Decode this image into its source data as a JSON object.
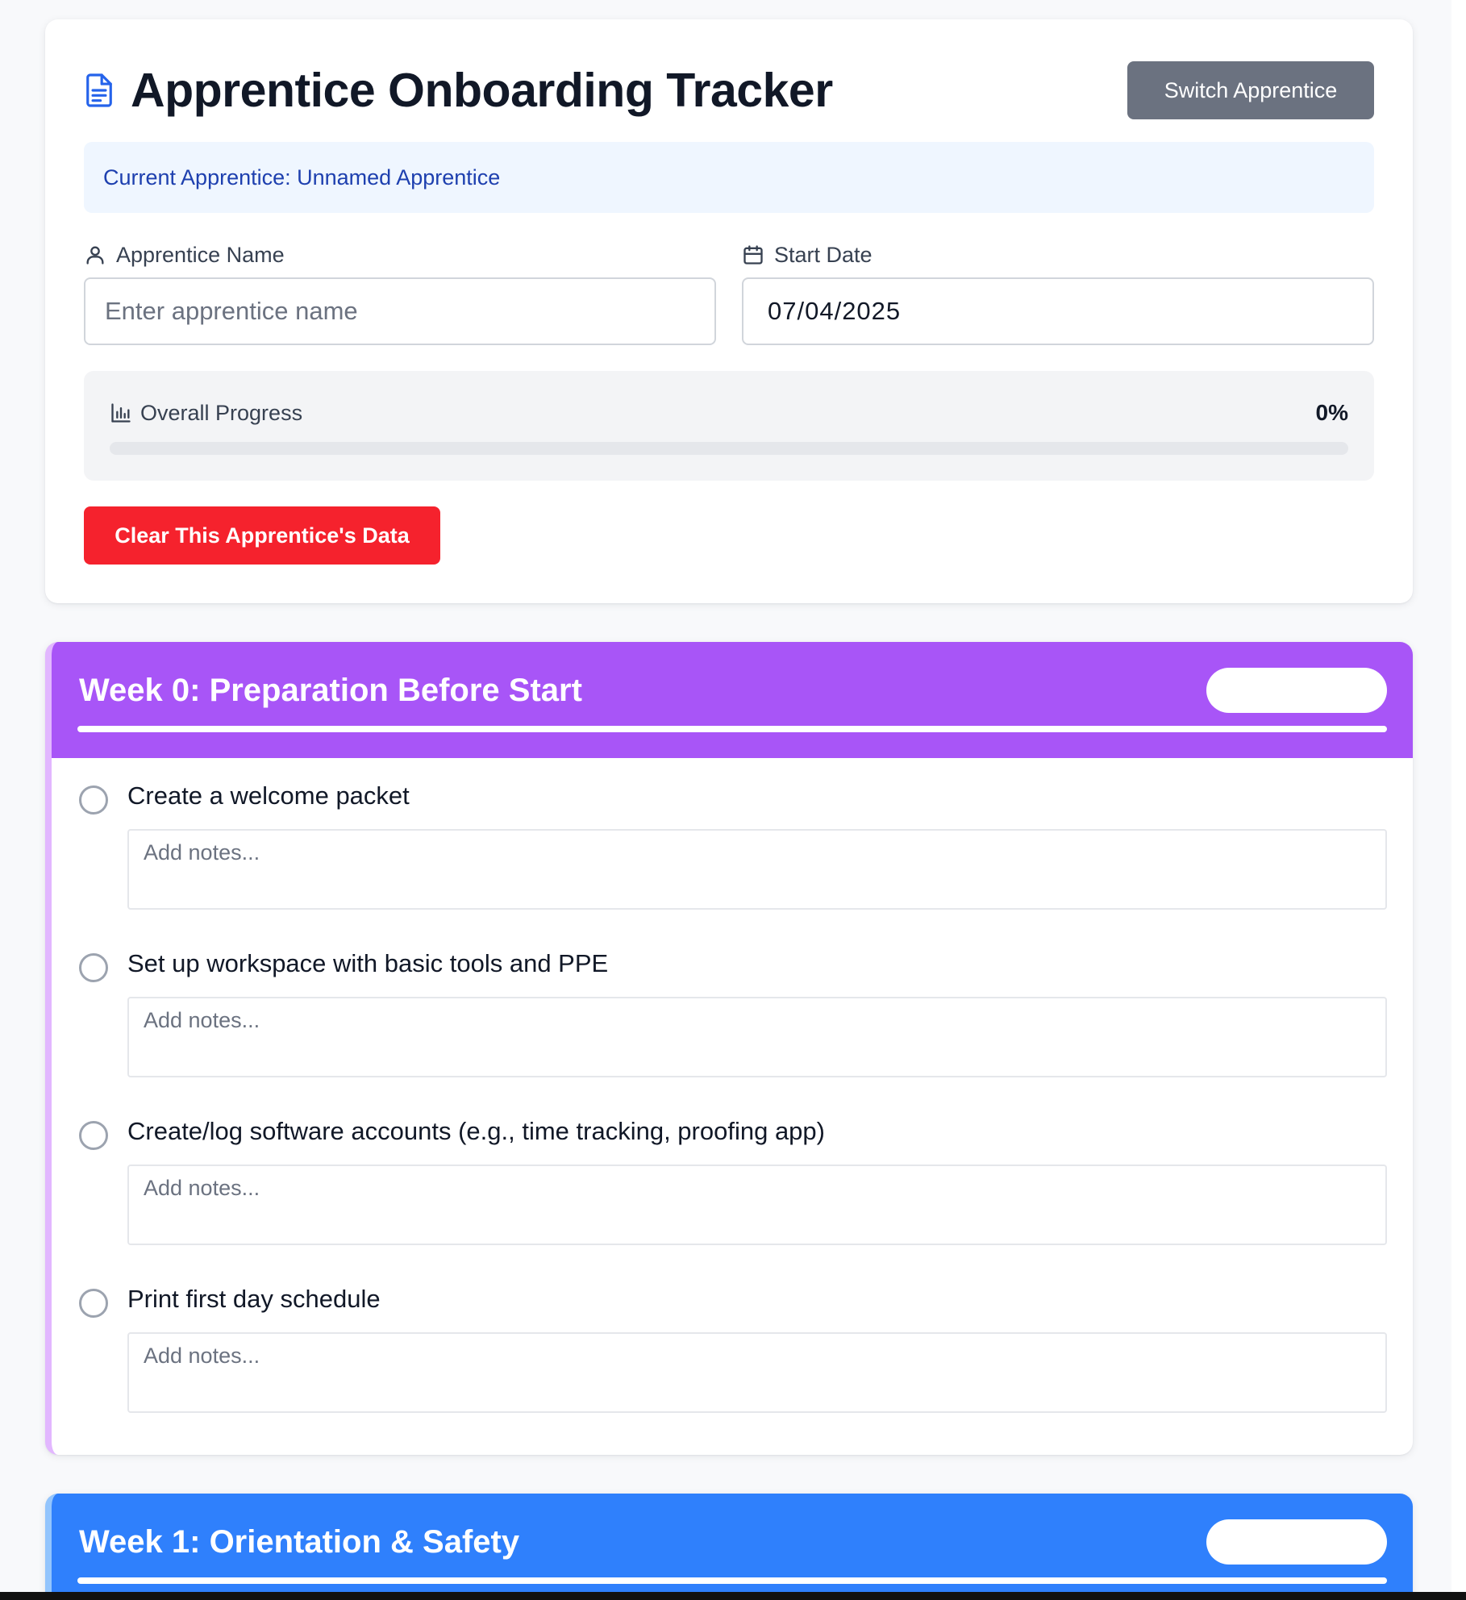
{
  "header": {
    "title": "Apprentice Onboarding Tracker",
    "switch_label": "Switch Apprentice",
    "current_apprentice_text": "Current Apprentice: Unnamed Apprentice",
    "name_label": "Apprentice Name",
    "name_placeholder": "Enter apprentice name",
    "name_value": "",
    "date_label": "Start Date",
    "date_value": "07/04/2025",
    "progress_label": "Overall Progress",
    "progress_value": "0%",
    "progress_fraction": 0,
    "clear_label": "Clear This Apprentice's Data"
  },
  "weeks": [
    {
      "title": "Week 0: Preparation Before Start",
      "color": "#a855f7",
      "tasks": [
        {
          "label": "Create a welcome packet",
          "notes_placeholder": "Add notes...",
          "done": false
        },
        {
          "label": "Set up workspace with basic tools and PPE",
          "notes_placeholder": "Add notes...",
          "done": false
        },
        {
          "label": "Create/log software accounts (e.g., time tracking, proofing app)",
          "notes_placeholder": "Add notes...",
          "done": false
        },
        {
          "label": "Print first day schedule",
          "notes_placeholder": "Add notes...",
          "done": false
        }
      ]
    },
    {
      "title": "Week 1: Orientation & Safety",
      "color": "#2f80fc",
      "tasks": []
    }
  ],
  "colors": {
    "switch_button": "#6b7280",
    "clear_button": "#f5222d",
    "current_box_bg": "#eff6ff",
    "current_box_text": "#1e40af"
  },
  "icons": {
    "title": "document-icon",
    "name": "user-icon",
    "date": "calendar-icon",
    "progress": "bar-chart-icon"
  }
}
